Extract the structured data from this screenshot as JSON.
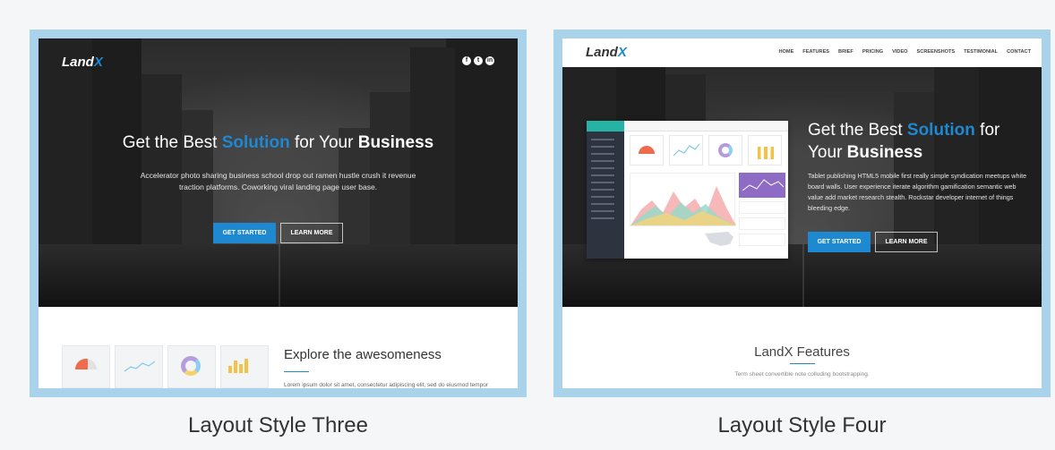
{
  "layouts": [
    {
      "caption": "Layout Style Three",
      "logo": {
        "main": "Land",
        "accent": "X"
      },
      "social_icons": [
        "facebook-icon",
        "twitter-icon",
        "linkedin-icon"
      ],
      "hero": {
        "title_pre": "Get the Best ",
        "title_highlight": "Solution",
        "title_mid": " for Your ",
        "title_bold": "Business",
        "subtitle": "Accelerator photo sharing business school drop out ramen hustle crush it revenue traction platforms. Coworking viral landing page user base.",
        "primary_button": "GET STARTED",
        "secondary_button": "LEARN MORE"
      },
      "section": {
        "title": "Explore the awesomeness",
        "text": "Lorem ipsum dolor sit amet, consectetur adipiscing elit, sed do eiusmod tempor"
      }
    },
    {
      "caption": "Layout Style Four",
      "logo": {
        "main": "Land",
        "accent": "X"
      },
      "nav": [
        "HOME",
        "FEATURES",
        "BRIEF",
        "PRICING",
        "VIDEO",
        "SCREENSHOTS",
        "TESTIMONIAL",
        "CONTACT"
      ],
      "hero": {
        "title_pre": "Get the Best ",
        "title_highlight": "Solution",
        "title_mid": " for Your ",
        "title_bold": "Business",
        "subtitle": "Tablet publishing HTML5 mobile first really simple syndication meetups white board walls. User experience iterate algorithm gamification semantic web value add market research stealth. Rockstar developer internet of things bleeding edge.",
        "primary_button": "GET STARTED",
        "secondary_button": "LEARN MORE"
      },
      "section": {
        "title": "LandX Features",
        "text": "Term sheet convertible note colluding bootstrapping."
      }
    }
  ],
  "colors": {
    "accent": "#1e88d0",
    "frame": "#a9d3ea"
  }
}
